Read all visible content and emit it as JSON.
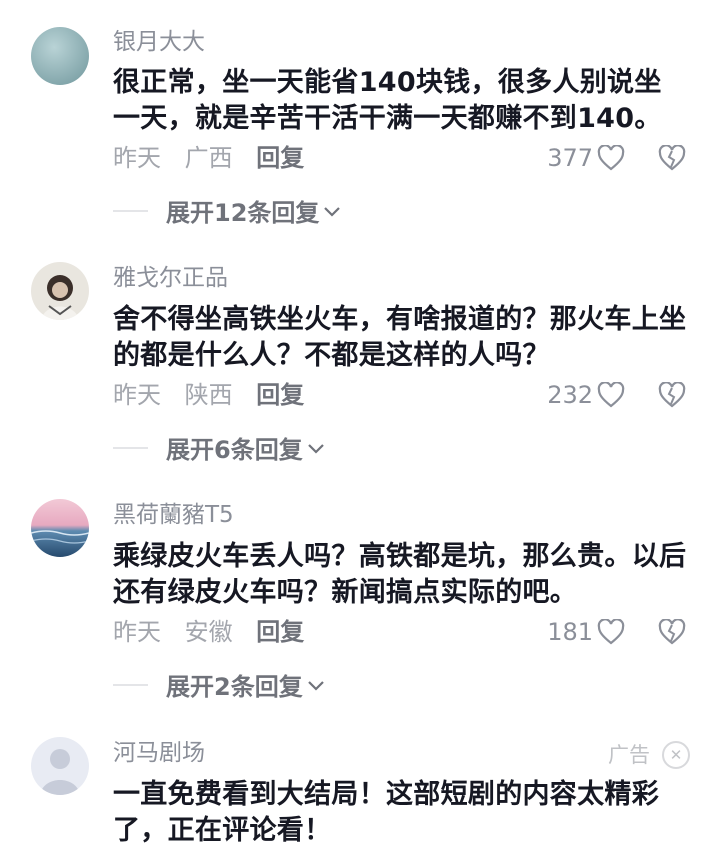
{
  "comments": [
    {
      "username": "银月大大",
      "text": "很正常，坐一天能省140块钱，很多人别说坐一天，就是辛苦干活干满一天都赚不到140。",
      "time": "昨天",
      "location": "广西",
      "reply_label": "回复",
      "likes": "377",
      "expand_label": "展开12条回复"
    },
    {
      "username": "雅戈尔正品",
      "text": "舍不得坐高铁坐火车，有啥报道的？那火车上坐的都是什么人？不都是这样的人吗？",
      "time": "昨天",
      "location": "陕西",
      "reply_label": "回复",
      "likes": "232",
      "expand_label": "展开6条回复"
    },
    {
      "username": "黑荷蘭豬T5",
      "text": "乘绿皮火车丢人吗？高铁都是坑，那么贵。以后还有绿皮火车吗？新闻搞点实际的吧。",
      "time": "昨天",
      "location": "安徽",
      "reply_label": "回复",
      "likes": "181",
      "expand_label": "展开2条回复"
    }
  ],
  "ad": {
    "username": "河马剧场",
    "label": "广告",
    "text": "一直免费看到大结局！这部短剧的内容太精彩了，正在评论看！"
  },
  "icons": {
    "like": "heart-outline-icon",
    "dislike": "broken-heart-icon",
    "expand": "chevron-down-icon",
    "close": "close-icon"
  }
}
